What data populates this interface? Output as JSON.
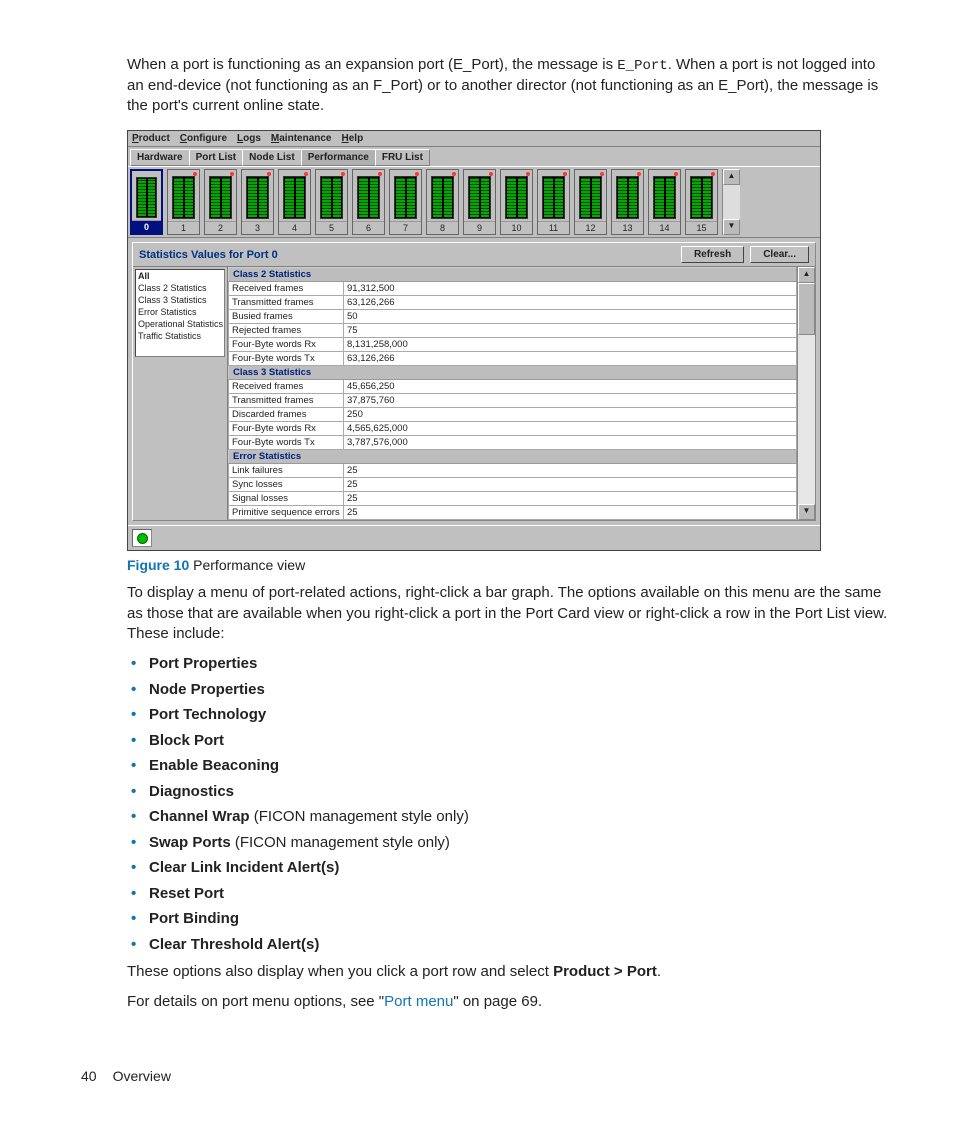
{
  "intro": {
    "part1": "When a port is functioning as an expansion port (E_Port), the message is ",
    "code": "E_Port",
    "part2": ". When a port is not logged into an end-device (not functioning as an F_Port) or to another director (not functioning as an E_Port), the message is the port's current online state."
  },
  "screenshot": {
    "menubar": [
      "Product",
      "Configure",
      "Logs",
      "Maintenance",
      "Help"
    ],
    "tabs": [
      "Hardware",
      "Port List",
      "Node List",
      "Performance",
      "FRU List"
    ],
    "active_tab_idx": 3,
    "ports": [
      "0",
      "1",
      "2",
      "3",
      "4",
      "5",
      "6",
      "7",
      "8",
      "9",
      "10",
      "11",
      "12",
      "13",
      "14",
      "15"
    ],
    "selected_port": 0,
    "stats_title": "Statistics Values for Port 0",
    "btn_refresh": "Refresh",
    "btn_clear": "Clear...",
    "categories": [
      "All",
      "Class 2 Statistics",
      "Class 3 Statistics",
      "Error Statistics",
      "Operational Statistics",
      "Traffic Statistics"
    ],
    "selected_category": "All",
    "groups": [
      {
        "title": "Class 2 Statistics",
        "rows": [
          [
            "Received frames",
            "91,312,500"
          ],
          [
            "Transmitted frames",
            "63,126,266"
          ],
          [
            "Busied frames",
            "50"
          ],
          [
            "Rejected frames",
            "75"
          ],
          [
            "Four-Byte words Rx",
            "8,131,258,000"
          ],
          [
            "Four-Byte words Tx",
            "63,126,266"
          ]
        ]
      },
      {
        "title": "Class 3 Statistics",
        "rows": [
          [
            "Received frames",
            "45,656,250"
          ],
          [
            "Transmitted frames",
            "37,875,760"
          ],
          [
            "Discarded frames",
            "250"
          ],
          [
            "Four-Byte words Rx",
            "4,565,625,000"
          ],
          [
            "Four-Byte words Tx",
            "3,787,576,000"
          ]
        ]
      },
      {
        "title": "Error Statistics",
        "rows": [
          [
            "Link failures",
            "25"
          ],
          [
            "Sync losses",
            "25"
          ],
          [
            "Signal losses",
            "25"
          ],
          [
            "Primitive sequence errors",
            "25"
          ]
        ]
      }
    ]
  },
  "figure": {
    "label": "Figure 10",
    "caption": " Performance view"
  },
  "para_after_fig": "To display a menu of port-related actions, right-click a bar graph. The options available on this menu are the same as those that are available when you right-click a port in the Port Card view or right-click a row in the Port List view. These include:",
  "menu_items": [
    {
      "bold": "Port Properties",
      "rest": ""
    },
    {
      "bold": "Node Properties",
      "rest": ""
    },
    {
      "bold": "Port Technology",
      "rest": ""
    },
    {
      "bold": "Block Port",
      "rest": ""
    },
    {
      "bold": "Enable Beaconing",
      "rest": ""
    },
    {
      "bold": "Diagnostics",
      "rest": ""
    },
    {
      "bold": "Channel Wrap",
      "rest": " (FICON management style only)"
    },
    {
      "bold": "Swap Ports",
      "rest": " (FICON management style only)"
    },
    {
      "bold": "Clear Link Incident Alert(s)",
      "rest": ""
    },
    {
      "bold": "Reset Port",
      "rest": ""
    },
    {
      "bold": "Port Binding",
      "rest": ""
    },
    {
      "bold": "Clear Threshold Alert(s)",
      "rest": ""
    }
  ],
  "closing1a": "These options also display when you click a port row and select ",
  "closing1b": "Product > Port",
  "closing1c": ".",
  "closing2a": "For details on port menu options, see \"",
  "closing2_link": "Port menu",
  "closing2b": "\" on page 69.",
  "footer": {
    "page": "40",
    "section": "Overview"
  }
}
